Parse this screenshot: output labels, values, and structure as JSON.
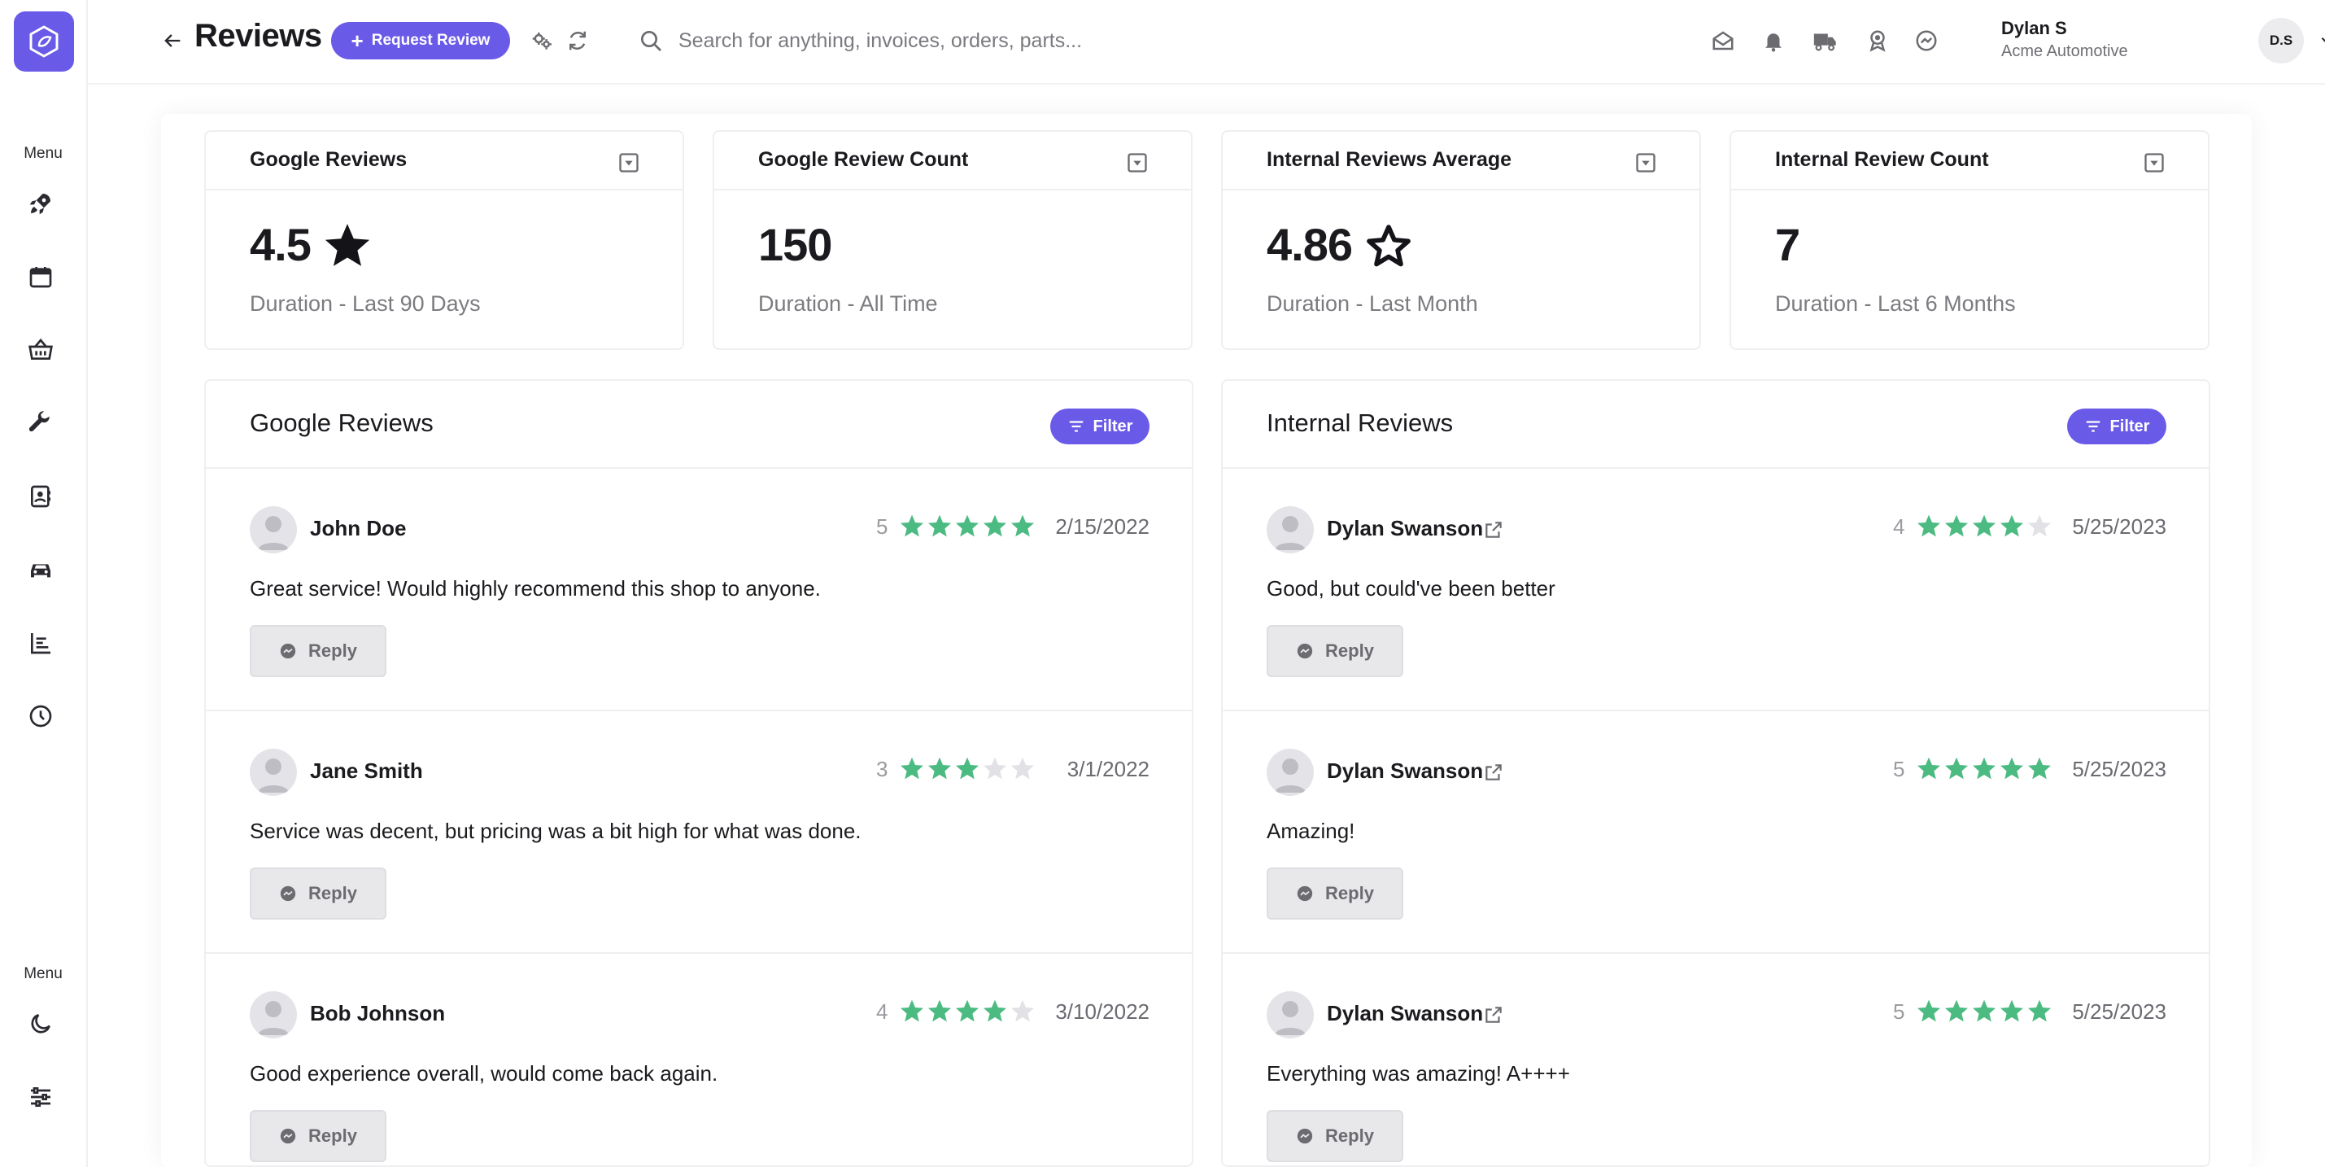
{
  "sidebar": {
    "menu_label_top": "Menu",
    "menu_label_bottom": "Menu",
    "items": [
      {
        "icon": "rocket-icon"
      },
      {
        "icon": "calendar-icon"
      },
      {
        "icon": "basket-icon"
      },
      {
        "icon": "wrench-icon"
      },
      {
        "icon": "contacts-icon"
      },
      {
        "icon": "car-icon"
      },
      {
        "icon": "reports-icon"
      },
      {
        "icon": "clock-icon"
      }
    ],
    "bottom_items": [
      {
        "icon": "moon-icon"
      },
      {
        "icon": "settings-sliders-icon"
      }
    ]
  },
  "header": {
    "title": "Reviews",
    "request_review_label": "Request Review",
    "search_placeholder": "Search for anything, invoices, orders, parts...",
    "user_name": "Dylan S",
    "user_company": "Acme Automotive",
    "avatar_initials": "D.S"
  },
  "stats": [
    {
      "title": "Google Reviews",
      "value": "4.5",
      "star": "filled",
      "subtitle": "Duration - Last 90 Days"
    },
    {
      "title": "Google Review Count",
      "value": "150",
      "star": "none",
      "subtitle": "Duration - All Time"
    },
    {
      "title": "Internal Reviews Average",
      "value": "4.86",
      "star": "outline",
      "subtitle": "Duration - Last Month"
    },
    {
      "title": "Internal Review Count",
      "value": "7",
      "star": "none",
      "subtitle": "Duration - Last 6 Months"
    }
  ],
  "google_panel": {
    "title": "Google Reviews",
    "filter_label": "Filter",
    "reviews": [
      {
        "name": "John Doe",
        "rating": "5",
        "stars": 5,
        "date": "2/15/2022",
        "text": "Great service! Would highly recommend this shop to anyone.",
        "reply_label": "Reply"
      },
      {
        "name": "Jane Smith",
        "rating": "3",
        "stars": 3,
        "date": "3/1/2022",
        "text": "Service was decent, but pricing was a bit high for what was done.",
        "reply_label": "Reply"
      },
      {
        "name": "Bob Johnson",
        "rating": "4",
        "stars": 4,
        "date": "3/10/2022",
        "text": "Good experience overall, would come back again.",
        "reply_label": "Reply"
      }
    ]
  },
  "internal_panel": {
    "title": "Internal Reviews",
    "filter_label": "Filter",
    "reviews": [
      {
        "name": "Dylan Swanson",
        "rating": "4",
        "stars": 4,
        "date": "5/25/2023",
        "text": "Good, but could've been better",
        "reply_label": "Reply"
      },
      {
        "name": "Dylan Swanson",
        "rating": "5",
        "stars": 5,
        "date": "5/25/2023",
        "text": "Amazing!",
        "reply_label": "Reply"
      },
      {
        "name": "Dylan Swanson",
        "rating": "5",
        "stars": 5,
        "date": "5/25/2023",
        "text": "Everything was amazing! A++++",
        "reply_label": "Reply"
      }
    ]
  },
  "colors": {
    "accent": "#6a5ae8",
    "star_filled": "#4cbb82",
    "star_empty": "#e2e2e6"
  }
}
